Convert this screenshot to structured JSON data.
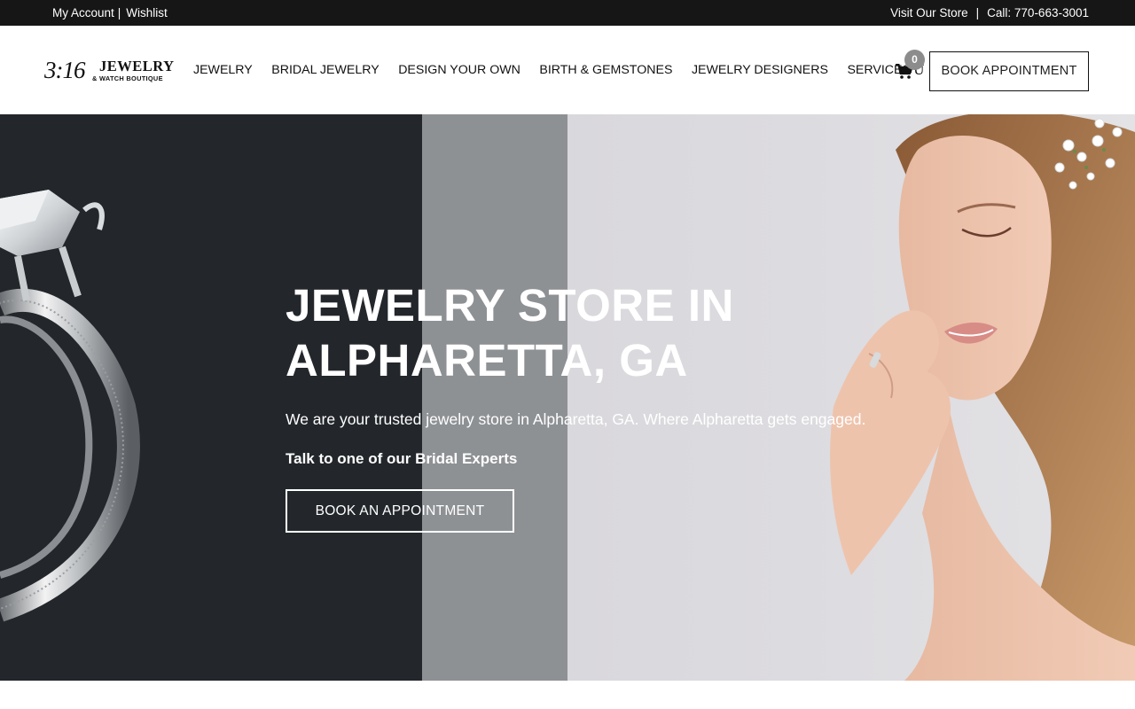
{
  "topbar": {
    "my_account": "My Account",
    "left_sep": "|",
    "wishlist": "Wishlist",
    "visit_store": "Visit Our Store",
    "right_sep": "|",
    "call": "Call: 770-663-3001"
  },
  "logo": {
    "number": "3:16",
    "word": "JEWELRY",
    "subtitle": "& WATCH BOUTIQUE"
  },
  "nav": {
    "items": [
      "JEWELRY",
      "BRIDAL JEWELRY",
      "DESIGN YOUR OWN",
      "BIRTH & GEMSTONES",
      "JEWELRY DESIGNERS",
      "SERVICES"
    ],
    "services_caret": "U"
  },
  "cart": {
    "count": "0",
    "icon": "cart-icon"
  },
  "header": {
    "book_label": "BOOK APPOINTMENT"
  },
  "hero": {
    "title_line1": "JEWELRY STORE IN",
    "title_line2": "ALPHARETTA, GA",
    "description": "We are your trusted jewelry store in Alpharetta, GA. Where Alpharetta gets engaged.",
    "talk": "Talk to one of our Bridal Experts",
    "cta_label": "BOOK AN APPOINTMENT"
  },
  "colors": {
    "topbar_bg": "#161616",
    "hero_dark": "#23272b",
    "hero_mid": "#8e9194",
    "hero_light": "#dcdbdf",
    "badge": "#8c8c8c"
  }
}
